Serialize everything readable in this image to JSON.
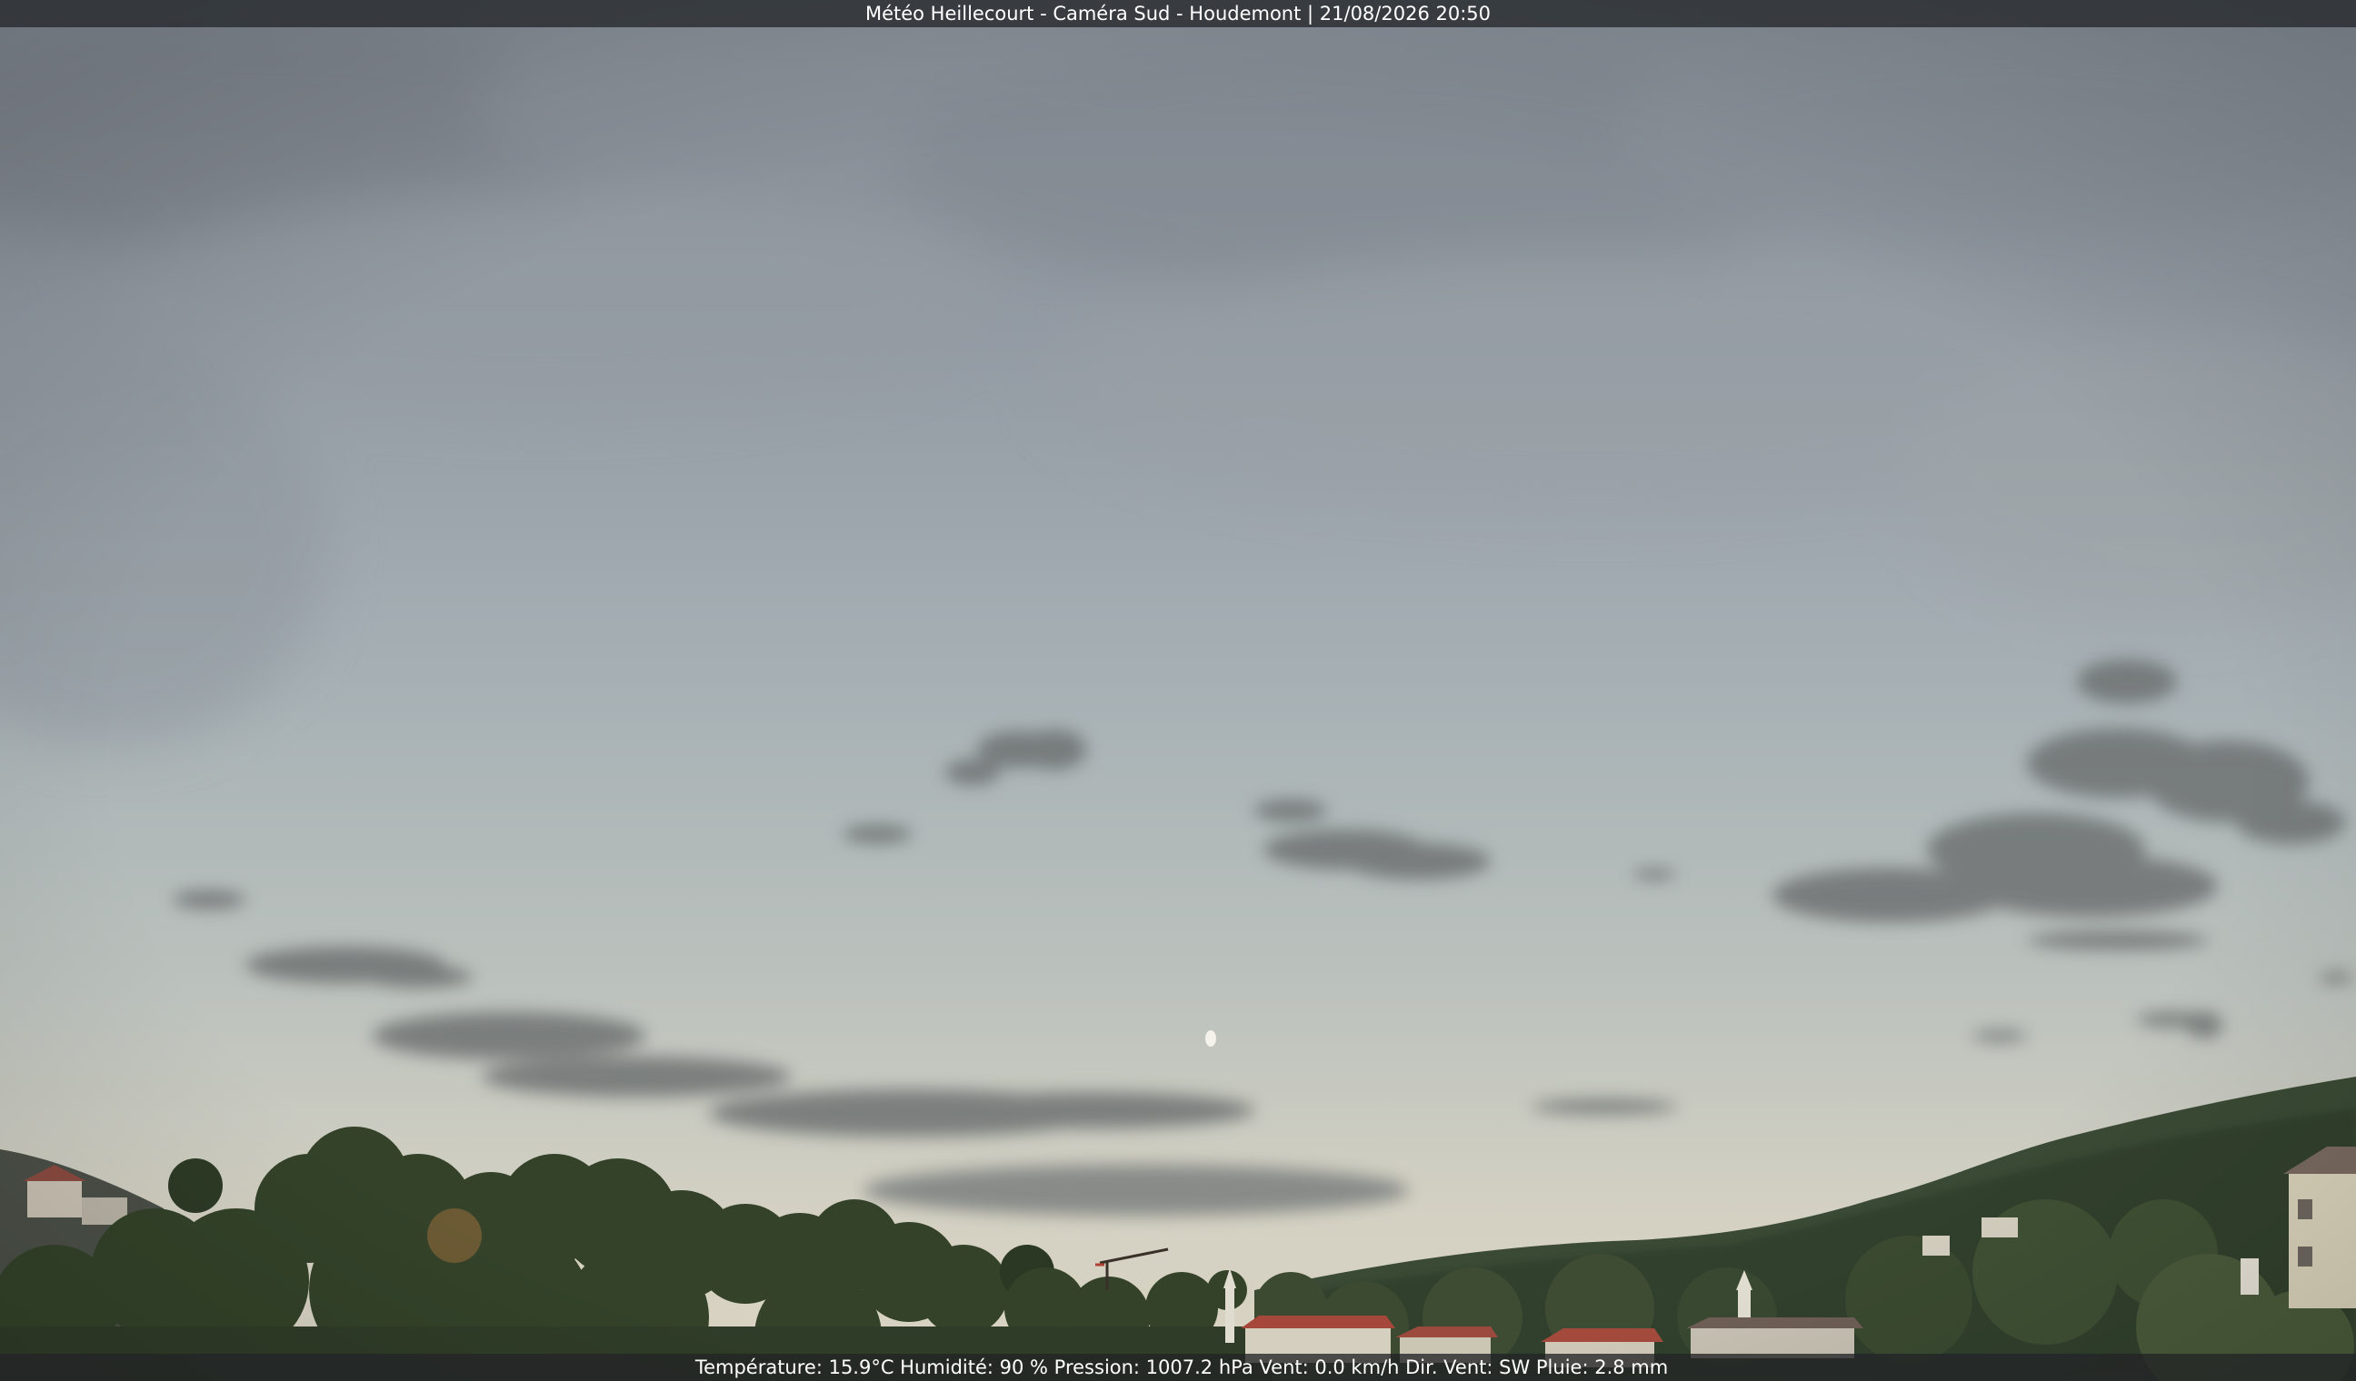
{
  "overlay": {
    "title": "Météo Heillecourt - Caméra Sud - Houdemont | 21/08/2026 20:50",
    "weather_line": "Température: 15.9°C  Humidité: 90 % Pression: 1007.2 hPa Vent: 0.0 km/h Dir. Vent: SW Pluie: 2.8 mm"
  },
  "colors": {
    "sky_top": "#8b929b",
    "sky_mid": "#a9b4b8",
    "sky_horizon": "#d7d2c3",
    "cloud_dark": "#6f7373",
    "trees": "#33432a",
    "hills": "#3a4a34",
    "roofs": "#a0473c",
    "overlay_bar": "#282c30",
    "overlay_text": "#ffffff"
  }
}
